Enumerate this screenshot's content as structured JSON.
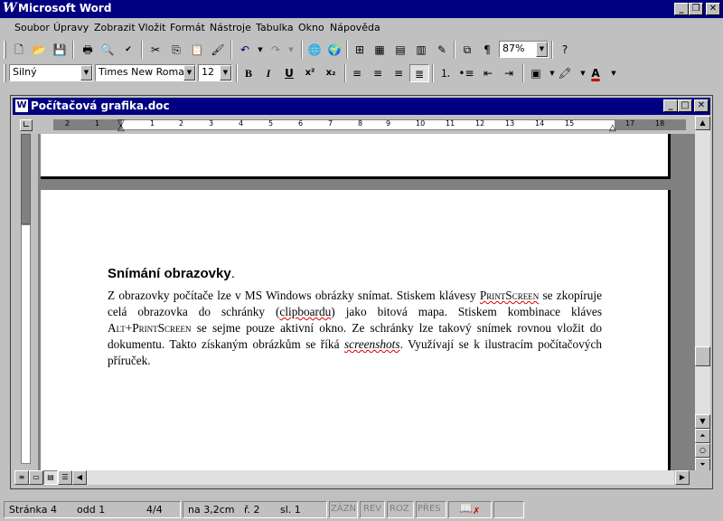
{
  "app": {
    "title": "Microsoft Word",
    "logo": "W"
  },
  "menu": [
    "Soubor",
    "Úpravy",
    "Zobrazit",
    "Vložit",
    "Formát",
    "Nástroje",
    "Tabulka",
    "Okno",
    "Nápověda"
  ],
  "toolbar_standard": {
    "zoom": "87%"
  },
  "toolbar_format": {
    "style": "Silný",
    "font": "Times New Roman",
    "size": "12"
  },
  "document": {
    "window_title": "Počítačová grafika.doc",
    "heading": "Snímání obrazovky",
    "heading_punct": ".",
    "para": {
      "p1": "Z obrazovky počítače lze v MS Windows obrázky snímat. Stiskem klávesy ",
      "key1": "PrintScreen",
      "p2": " se zkopíruje celá obrazovka do schránky (",
      "word_clipboard": "clipboardu",
      "p3": ") jako bitová mapa. Stiskem kombinace kláves ",
      "key2": "Alt+PrintScreen",
      "p4": " se sejme pouze aktivní okno. Ze schránky lze takový snímek rovnou vložit do dokumentu. Takto získaným obrázkům se říká ",
      "word_screenshots": "screenshots",
      "p5": ". Využívají se k ilustracím počítačových příruček."
    }
  },
  "ruler": [
    "2",
    "1",
    "1",
    "2",
    "3",
    "4",
    "5",
    "6",
    "7",
    "8",
    "9",
    "10",
    "11",
    "12",
    "13",
    "14",
    "15",
    "16",
    "17",
    "18"
  ],
  "statusbar": {
    "page": "Stránka 4",
    "section": "odd 1",
    "pages": "4/4",
    "at": "na 3,2cm",
    "line": "ř. 2",
    "col": "sl. 1",
    "rec": "ZÁZN",
    "rev": "REV",
    "ext": "ROZ",
    "ovr": "PŘES"
  }
}
